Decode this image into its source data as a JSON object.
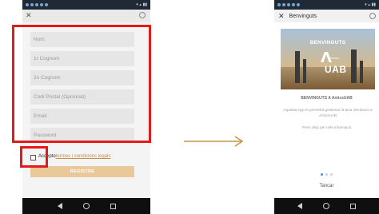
{
  "left_phone": {
    "form": {
      "fields": [
        {
          "placeholder": "Nom"
        },
        {
          "placeholder": "1r Cognom"
        },
        {
          "placeholder": "2n Cognom"
        },
        {
          "placeholder": "Codi Postal (Opcional)"
        },
        {
          "placeholder": "Email"
        },
        {
          "placeholder": "Password"
        }
      ],
      "accept_text": "Accepto",
      "accept_link": "termes i condicions legals",
      "register_label": "REGISTRE"
    }
  },
  "right_phone": {
    "header_title": "Benvinguts",
    "banner": {
      "welcome": "BENVINGUTS",
      "logo_amics": "Amics",
      "logo_uab": "UAB"
    },
    "heading": "BENVINGUTS A AmicsUAB",
    "description": "Aquesta App et permetrà gestionar la teva vinculació a AmicsUAB",
    "skip_text": "Prem Skip per més informació",
    "pager": {
      "total": 3,
      "active": 1
    },
    "close_label": "Tancar"
  },
  "colors": {
    "highlight": "#e61919",
    "arrow": "#c9914a",
    "accent_link": "#c48f4f",
    "register_button": "#e9c99a",
    "pager_active": "#4a8fd8"
  },
  "icons": {
    "close": "close-icon",
    "arrow": "right-arrow-icon",
    "nav_back": "back-triangle-icon",
    "nav_home": "home-circle-icon",
    "nav_recent": "recent-square-icon"
  }
}
